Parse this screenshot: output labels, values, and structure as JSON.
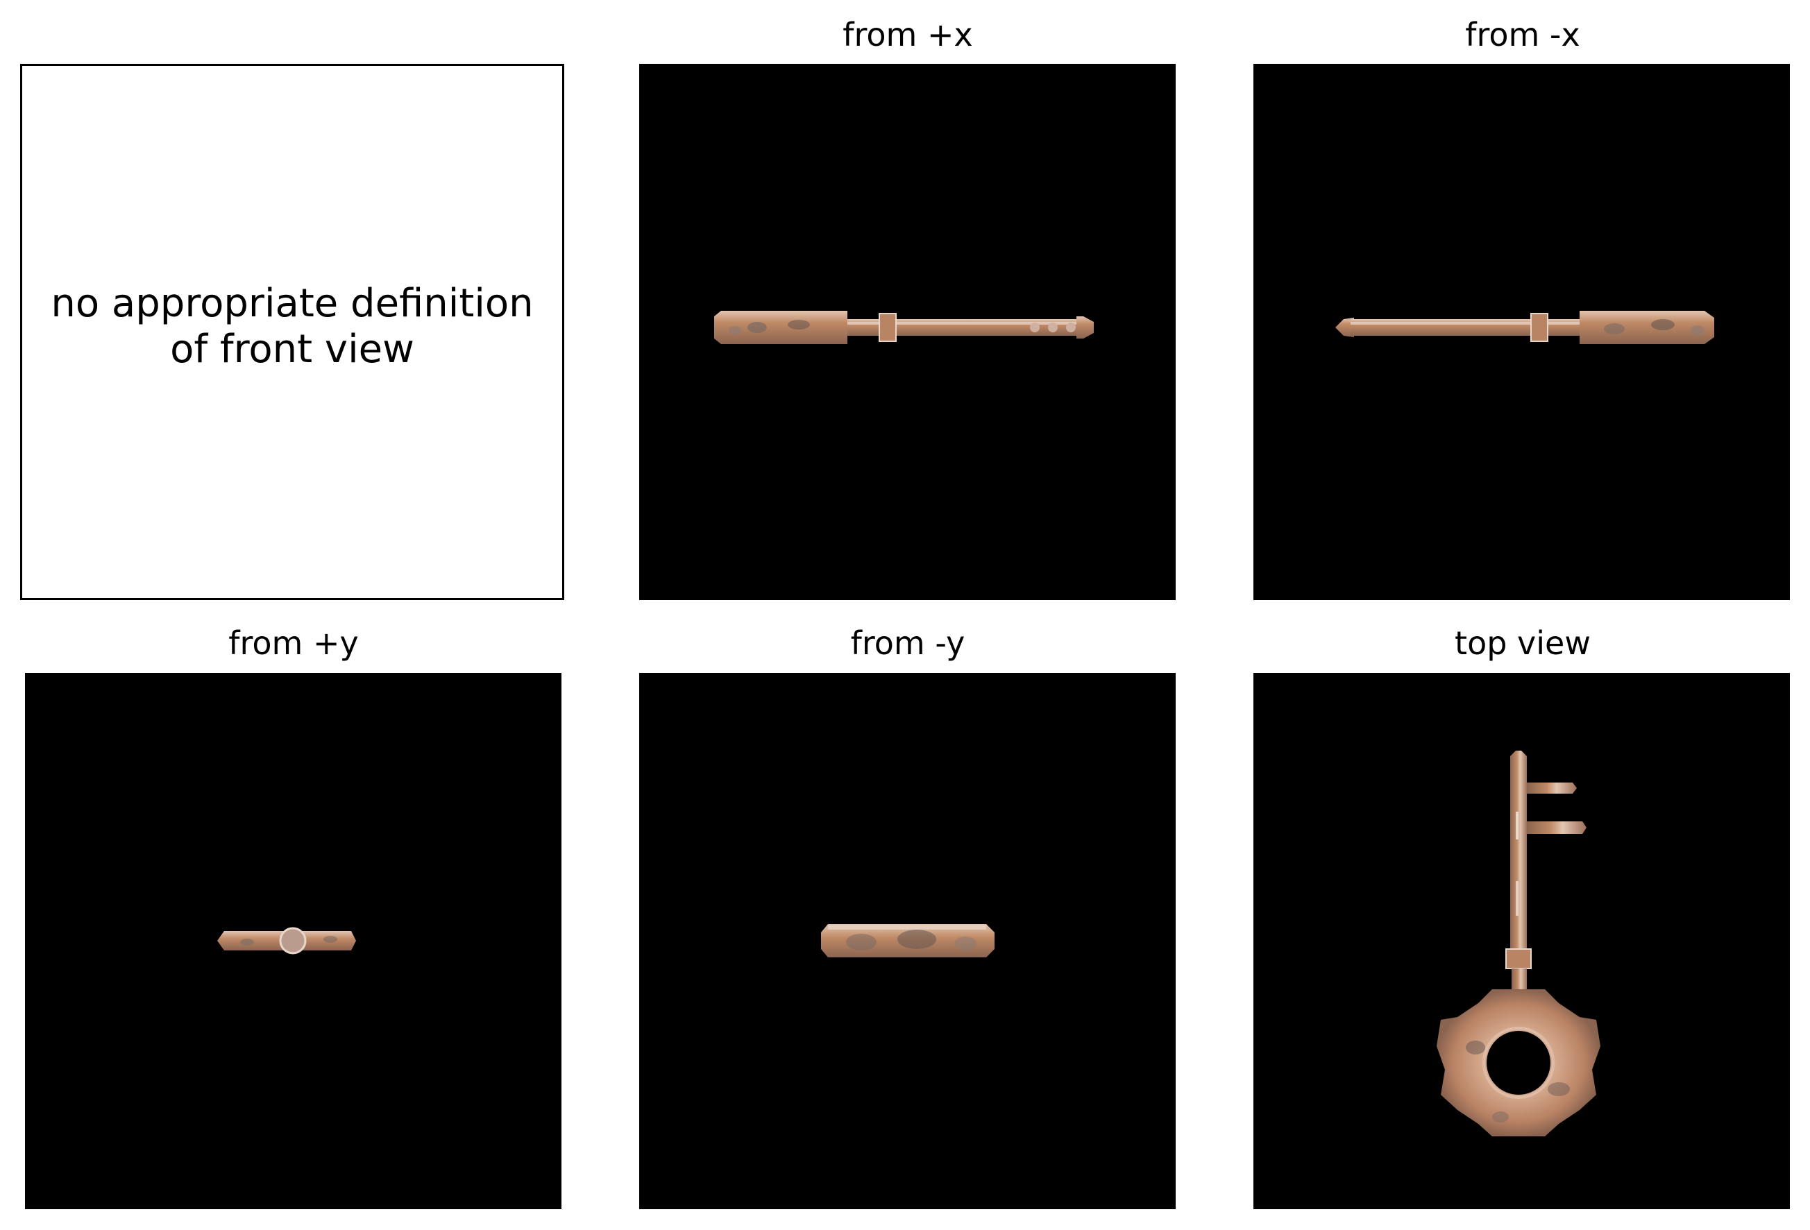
{
  "note": {
    "line1": "no appropriate definition",
    "line2": "of front view"
  },
  "views": [
    {
      "title": "from +x",
      "subject": "key-side-view"
    },
    {
      "title": "from -x",
      "subject": "key-side-view-mirrored"
    },
    {
      "title": "from +y",
      "subject": "key-end-view-small"
    },
    {
      "title": "from -y",
      "subject": "key-end-view-bow"
    },
    {
      "title": "top view",
      "subject": "key-top-view"
    }
  ],
  "colors": {
    "background": "#000000",
    "key_copper": "#c08a66",
    "key_highlight": "#e8d8cc",
    "key_shadow": "#6d5a52"
  }
}
